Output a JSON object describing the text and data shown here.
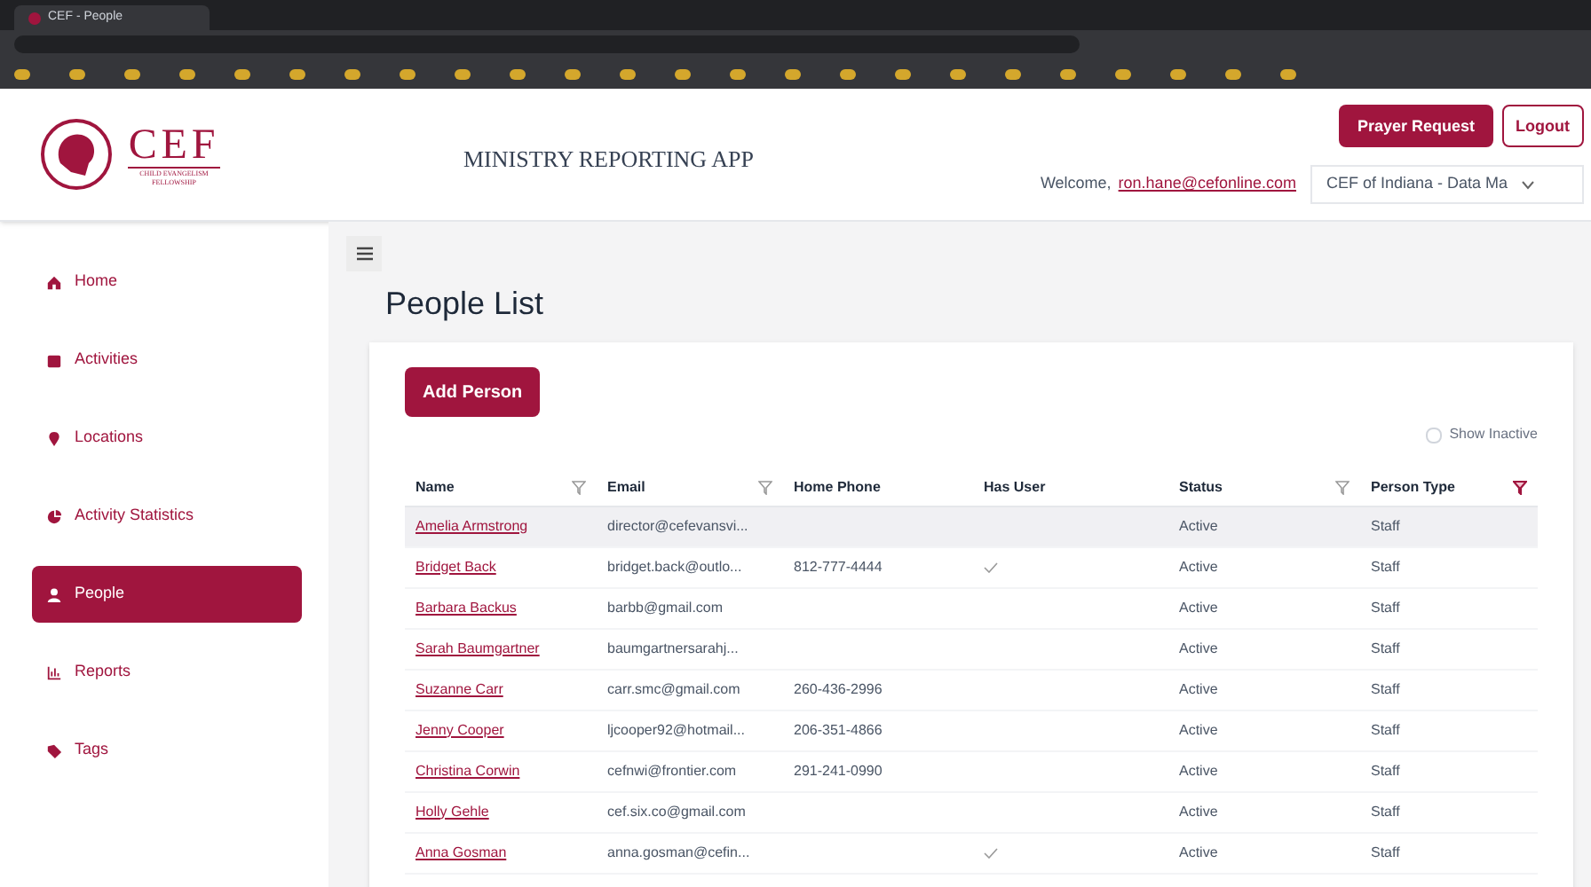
{
  "browser": {
    "tab_title": "CEF - People"
  },
  "header": {
    "logo_text": "CEF",
    "logo_subtitle": "CHILD EVANGELISM FELLOWSHIP",
    "app_title": "MINISTRY REPORTING APP",
    "buttons": [
      "Prayer Request",
      "Logout"
    ],
    "welcome": "Welcome,",
    "user_email": "ron.hane@cefonline.com",
    "org_select": "CEF of Indiana - Data Ma"
  },
  "sidebar": {
    "items": [
      {
        "label": "Home",
        "selected": false
      },
      {
        "label": "Activities",
        "selected": false
      },
      {
        "label": "Locations",
        "selected": false
      },
      {
        "label": "Activity Statistics",
        "selected": false
      },
      {
        "label": "People",
        "selected": true
      },
      {
        "label": "Reports",
        "selected": false
      },
      {
        "label": "Tags",
        "selected": false
      }
    ]
  },
  "page": {
    "title": "People List",
    "add_button": "Add Person",
    "show_inactive": {
      "label": "Show Inactive",
      "checked": false
    }
  },
  "table": {
    "columns": [
      {
        "label": "Name",
        "filter": true,
        "filtered": false
      },
      {
        "label": "Email",
        "filter": true,
        "filtered": false
      },
      {
        "label": "Home Phone",
        "filter": false
      },
      {
        "label": "Has User",
        "filter": false
      },
      {
        "label": "Status",
        "filter": true,
        "filtered": false
      },
      {
        "label": "Person Type",
        "filter": true,
        "filtered": true
      }
    ],
    "rows": [
      {
        "name": "Amelia Armstrong",
        "email": "director@cefevansvi...",
        "phone": "",
        "has_user": false,
        "status": "Active",
        "type": "Staff",
        "selected": true
      },
      {
        "name": "Bridget Back",
        "email": "bridget.back@outlo...",
        "phone": "812-777-4444",
        "has_user": true,
        "status": "Active",
        "type": "Staff",
        "selected": false
      },
      {
        "name": "Barbara Backus",
        "email": "barbb@gmail.com",
        "phone": "",
        "has_user": false,
        "status": "Active",
        "type": "Staff",
        "selected": false
      },
      {
        "name": "Sarah Baumgartner",
        "email": "baumgartnersarahj...",
        "phone": "",
        "has_user": false,
        "status": "Active",
        "type": "Staff",
        "selected": false
      },
      {
        "name": "Suzanne Carr",
        "email": "carr.smc@gmail.com",
        "phone": "260-436-2996",
        "has_user": false,
        "status": "Active",
        "type": "Staff",
        "selected": false
      },
      {
        "name": "Jenny Cooper",
        "email": "ljcooper92@hotmail...",
        "phone": "206-351-4866",
        "has_user": false,
        "status": "Active",
        "type": "Staff",
        "selected": false
      },
      {
        "name": "Christina Corwin",
        "email": "cefnwi@frontier.com",
        "phone": "291-241-0990",
        "has_user": false,
        "status": "Active",
        "type": "Staff",
        "selected": false
      },
      {
        "name": "Holly Gehle",
        "email": "cef.six.co@gmail.com",
        "phone": "",
        "has_user": false,
        "status": "Active",
        "type": "Staff",
        "selected": false
      },
      {
        "name": "Anna Gosman",
        "email": "anna.gosman@cefin...",
        "phone": "",
        "has_user": true,
        "status": "Active",
        "type": "Staff",
        "selected": false
      }
    ]
  }
}
